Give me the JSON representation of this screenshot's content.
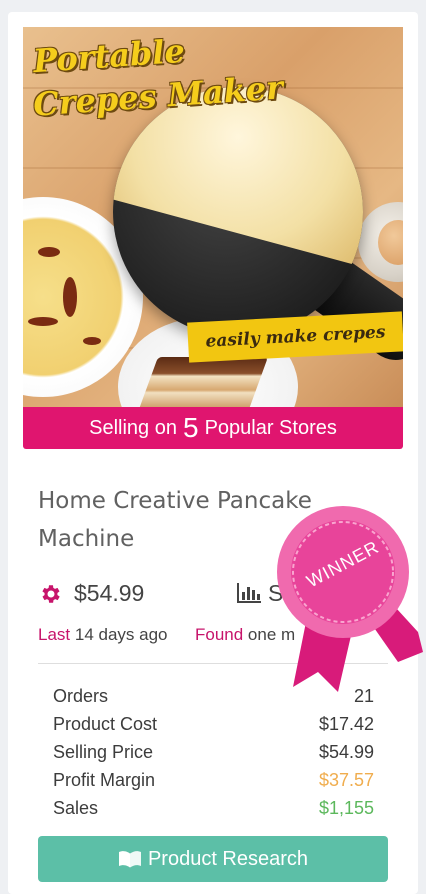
{
  "image": {
    "headline_1": "Portable",
    "headline_2": "Crepes Maker",
    "tagline": "easily make crepes"
  },
  "banner": {
    "prefix": "Selling on",
    "count": "5",
    "suffix": "Popular Stores"
  },
  "product": {
    "name": "Home Creative Pancake Machine",
    "price": "$54.99",
    "stat_label": "S",
    "last_label": "Last",
    "last_value": "14 days ago",
    "found_label": "Found",
    "found_value": "one m"
  },
  "stats": [
    {
      "label": "Orders",
      "value": "21"
    },
    {
      "label": "Product Cost",
      "value": "$17.42"
    },
    {
      "label": "Selling Price",
      "value": "$54.99"
    },
    {
      "label": "Profit Margin",
      "value": "$37.57"
    },
    {
      "label": "Sales",
      "value": "$1,155"
    }
  ],
  "badge": {
    "text": "WINNER"
  },
  "button": {
    "label": "Product Research"
  },
  "colors": {
    "brand_pink": "#e0156f",
    "button_teal": "#5cbfa7",
    "profit": "#f0ad4e",
    "sales": "#5cb85c"
  },
  "icons": [
    "gear-icon",
    "bar-chart-icon",
    "book-icon",
    "winner-rosette-icon"
  ]
}
